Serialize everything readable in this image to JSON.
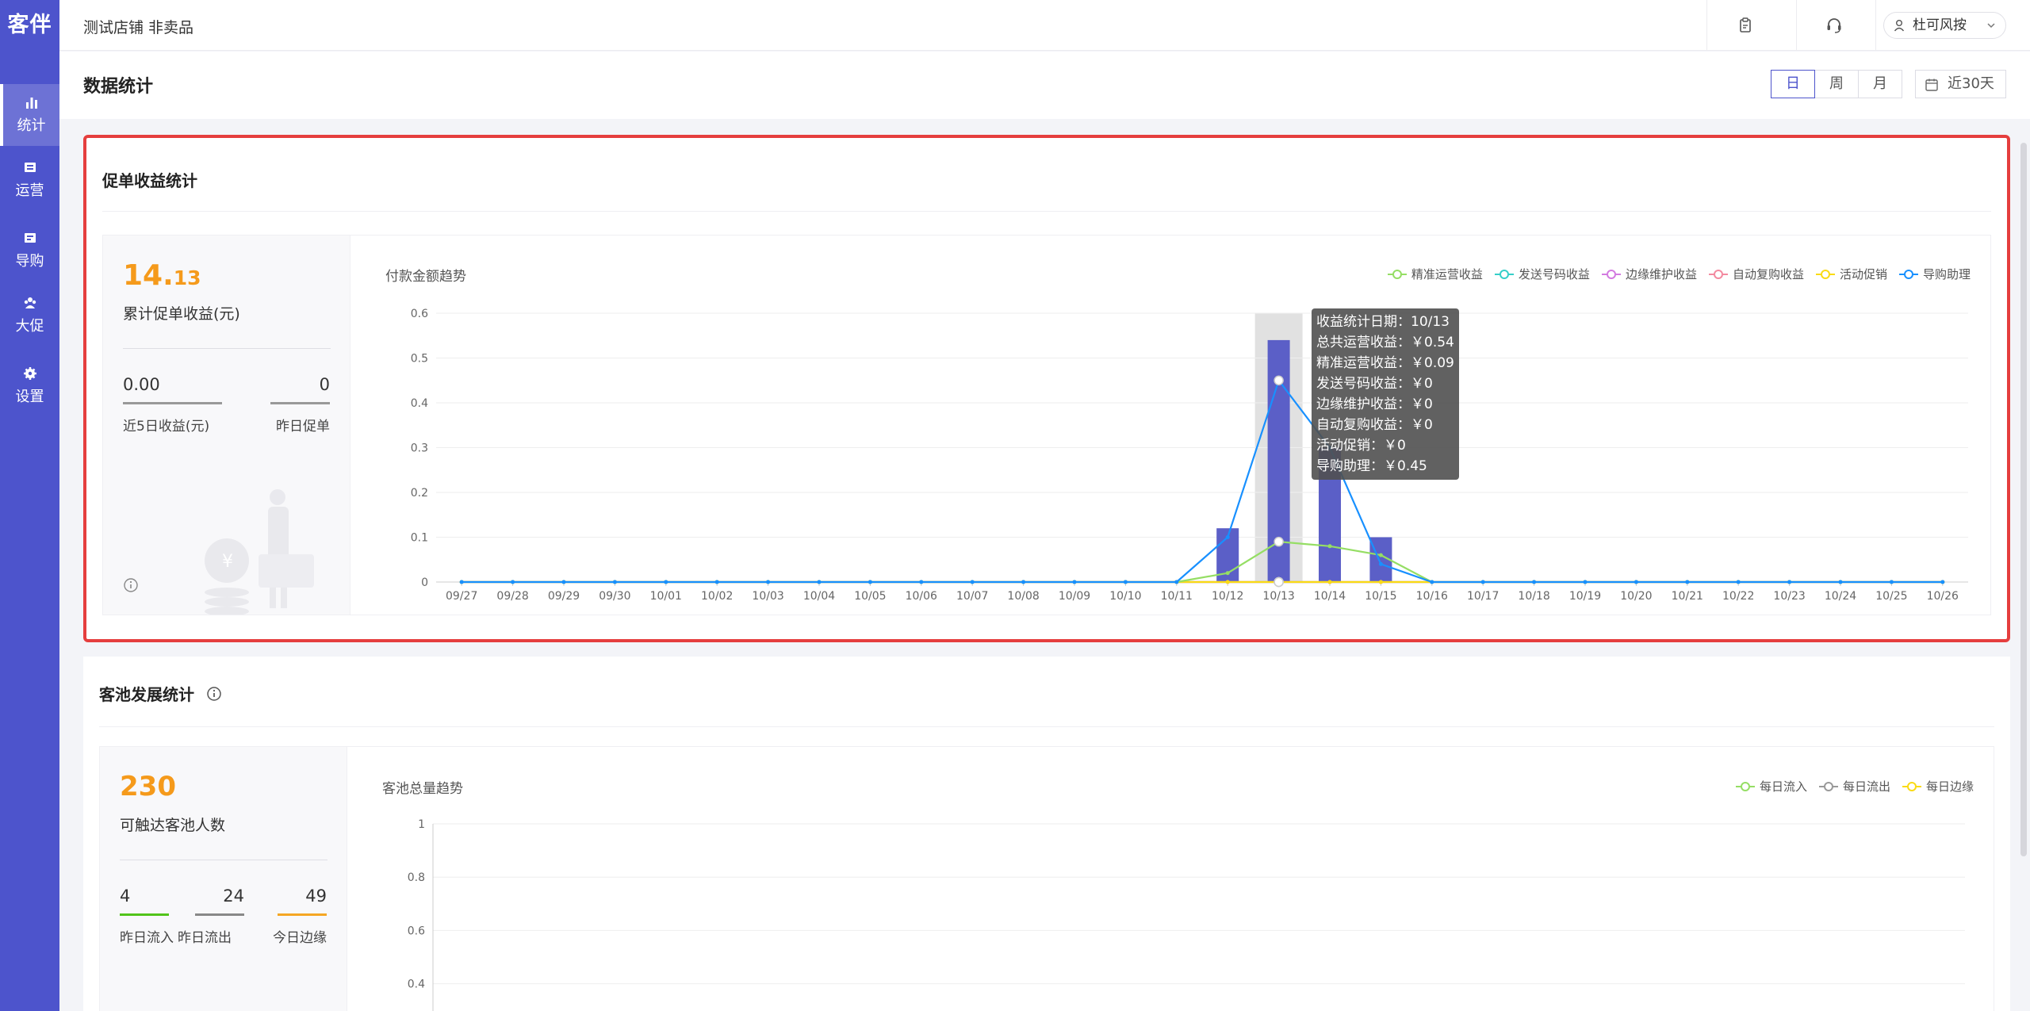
{
  "app": {
    "logo": "客伴"
  },
  "sidebar": {
    "items": [
      {
        "label": "统计",
        "icon": "bar-chart-icon",
        "active": true
      },
      {
        "label": "运营",
        "icon": "operation-icon",
        "active": false
      },
      {
        "label": "导购",
        "icon": "guide-icon",
        "active": false
      },
      {
        "label": "大促",
        "icon": "people-icon",
        "active": false
      },
      {
        "label": "设置",
        "icon": "gear-icon",
        "active": false
      }
    ]
  },
  "header": {
    "shop_name": "测试店铺 非卖品",
    "icons": [
      "clipboard-icon",
      "headset-icon"
    ],
    "user_name": "杜可风按"
  },
  "page": {
    "title": "数据统计",
    "period_buttons": [
      "日",
      "周",
      "月"
    ],
    "active_period": "日",
    "date_range": "近30天"
  },
  "revenue_card": {
    "title": "促单收益统计",
    "total_int": "14.",
    "total_dec": "13",
    "total_label": "累计促单收益(元)",
    "stats": [
      {
        "value": "0.00",
        "label": "近5日收益(元)"
      },
      {
        "value": "0",
        "label": "昨日促单"
      }
    ],
    "info_icon": "info-icon"
  },
  "pool_card": {
    "title": "客池发展统计",
    "total": "230",
    "total_label": "可触达客池人数",
    "stats": [
      {
        "value": "4",
        "label": "昨日流入",
        "color": "#52c41a"
      },
      {
        "value": "24",
        "label": "昨日流出",
        "color": "#888888"
      },
      {
        "value": "49",
        "label": "今日边缘",
        "color": "#f5a623"
      }
    ]
  },
  "chart_data": [
    {
      "type": "line",
      "title": "付款金额趋势",
      "categories": [
        "09/27",
        "09/28",
        "09/29",
        "09/30",
        "10/01",
        "10/02",
        "10/03",
        "10/04",
        "10/05",
        "10/06",
        "10/07",
        "10/08",
        "10/09",
        "10/10",
        "10/11",
        "10/12",
        "10/13",
        "10/14",
        "10/15",
        "10/16",
        "10/17",
        "10/18",
        "10/19",
        "10/20",
        "10/21",
        "10/22",
        "10/23",
        "10/24",
        "10/25",
        "10/26"
      ],
      "ylim": [
        0,
        0.6
      ],
      "yticks": [
        "0",
        "0.1",
        "0.2",
        "0.3",
        "0.4",
        "0.5",
        "0.6"
      ],
      "grid": true,
      "legend_position": "top-right",
      "bars": {
        "color": "#5b5fc7",
        "values": [
          0,
          0,
          0,
          0,
          0,
          0,
          0,
          0,
          0,
          0,
          0,
          0,
          0,
          0,
          0,
          0.12,
          0.54,
          0.3,
          0.1,
          0,
          0,
          0,
          0,
          0,
          0,
          0,
          0,
          0,
          0,
          0
        ]
      },
      "series": [
        {
          "name": "精准运营收益",
          "color": "#95de64",
          "values": [
            0,
            0,
            0,
            0,
            0,
            0,
            0,
            0,
            0,
            0,
            0,
            0,
            0,
            0,
            0,
            0.02,
            0.09,
            0.08,
            0.06,
            0,
            0,
            0,
            0,
            0,
            0,
            0,
            0,
            0,
            0,
            0
          ]
        },
        {
          "name": "发送号码收益",
          "color": "#36cfc9",
          "values": [
            0,
            0,
            0,
            0,
            0,
            0,
            0,
            0,
            0,
            0,
            0,
            0,
            0,
            0,
            0,
            0,
            0,
            0,
            0,
            0,
            0,
            0,
            0,
            0,
            0,
            0,
            0,
            0,
            0,
            0
          ]
        },
        {
          "name": "边缘维护收益",
          "color": "#d37be0",
          "values": [
            0,
            0,
            0,
            0,
            0,
            0,
            0,
            0,
            0,
            0,
            0,
            0,
            0,
            0,
            0,
            0,
            0,
            0,
            0,
            0,
            0,
            0,
            0,
            0,
            0,
            0,
            0,
            0,
            0,
            0
          ]
        },
        {
          "name": "自动复购收益",
          "color": "#f38aa0",
          "values": [
            0,
            0,
            0,
            0,
            0,
            0,
            0,
            0,
            0,
            0,
            0,
            0,
            0,
            0,
            0,
            0,
            0,
            0,
            0,
            0,
            0,
            0,
            0,
            0,
            0,
            0,
            0,
            0,
            0,
            0
          ]
        },
        {
          "name": "活动促销",
          "color": "#fadb14",
          "values": [
            0,
            0,
            0,
            0,
            0,
            0,
            0,
            0,
            0,
            0,
            0,
            0,
            0,
            0,
            0,
            0,
            0,
            0,
            0,
            0,
            0,
            0,
            0,
            0,
            0,
            0,
            0,
            0,
            0,
            0
          ]
        },
        {
          "name": "导购助理",
          "color": "#1890ff",
          "values": [
            0,
            0,
            0,
            0,
            0,
            0,
            0,
            0,
            0,
            0,
            0,
            0,
            0,
            0,
            0,
            0.1,
            0.45,
            0.3,
            0.04,
            0,
            0,
            0,
            0,
            0,
            0,
            0,
            0,
            0,
            0,
            0
          ]
        }
      ],
      "highlight_index": 16,
      "tooltip": [
        "收益统计日期：10/13",
        "总共运营收益：￥0.54",
        "精准运营收益：￥0.09",
        "发送号码收益：￥0",
        "边缘维护收益：￥0",
        "自动复购收益：￥0",
        "活动促销：￥0",
        "导购助理：￥0.45"
      ]
    },
    {
      "type": "line",
      "title": "客池总量趋势",
      "ylim": [
        0,
        1
      ],
      "yticks": [
        "0.4",
        "0.6",
        "0.8",
        "1"
      ],
      "grid": true,
      "legend_position": "top-right",
      "series": [
        {
          "name": "每日流入",
          "color": "#95de64",
          "values": []
        },
        {
          "name": "每日流出",
          "color": "#999999",
          "values": []
        },
        {
          "name": "每日边缘",
          "color": "#fadb14",
          "values": []
        }
      ]
    }
  ]
}
